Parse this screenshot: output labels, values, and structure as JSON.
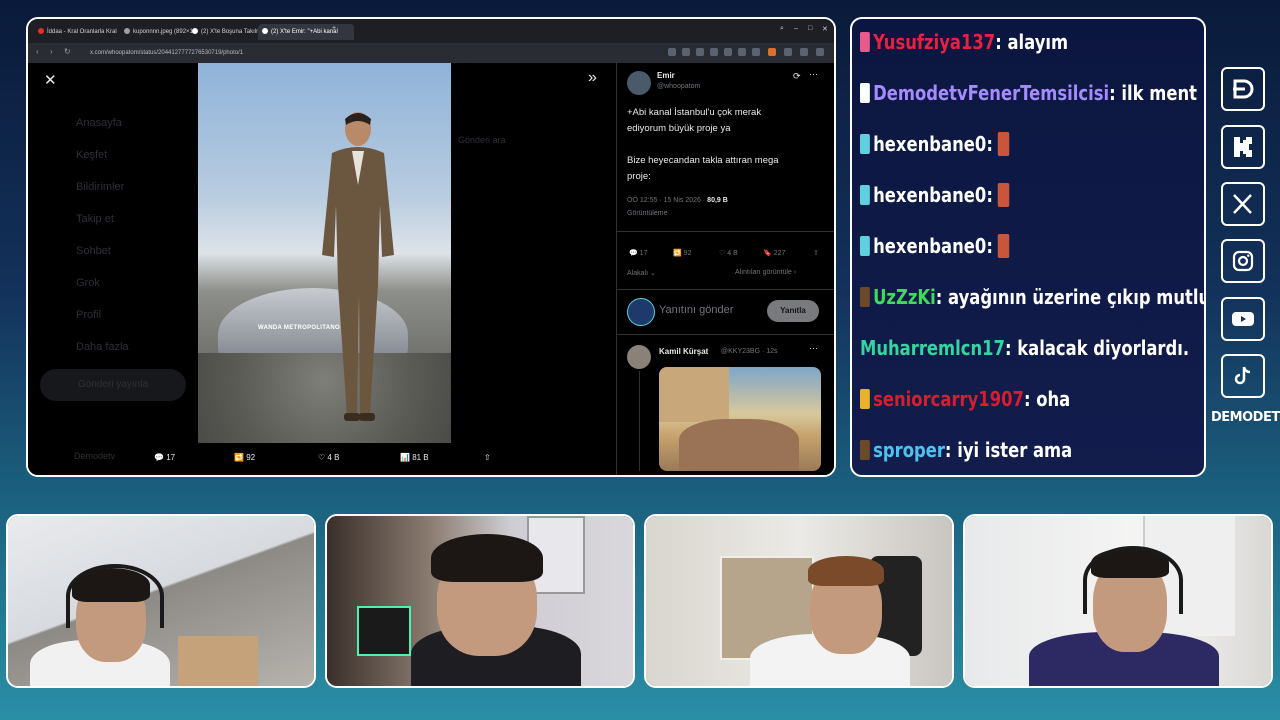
{
  "browser": {
    "tabs": [
      {
        "label": "İddaa - Kral Oranlarla Kral"
      },
      {
        "label": "kuponnnn.jpeg (892×1"
      },
      {
        "label": "(2) X'te Boşuna Takılma"
      },
      {
        "label": "(2) X'te Emir: \"+Abi kanal"
      }
    ],
    "url": "x.com/whoopatom/status/2044127777276530719/photo/1",
    "background_nav": [
      "Anasayfa",
      "Keşfet",
      "Bildirimler",
      "Takip et",
      "Sohbet",
      "Grok",
      "Profil",
      "Daha fazla"
    ],
    "background_button": "Gönderi yayınla",
    "background_user": "Demodetv",
    "background_search_hint": "Gönderi ara",
    "stadium_sign": "WANDA METROPOLITANO",
    "media_actions": {
      "replies": "17",
      "reposts": "92",
      "likes": "4 B",
      "views": "81 B"
    }
  },
  "tweet": {
    "name": "Emir",
    "handle": "@whoopatom",
    "text_line1": "+Abi kanal İstanbul'u çok merak",
    "text_line2": "ediyorum büyük proje ya",
    "text_line3": "Bize heyecandan takla attıran mega",
    "text_line4": "proje:",
    "timestamp": "ÖÖ 12:55 · 15 Nis 2026 ·",
    "views": "80,9 B",
    "views_label": "Görüntüleme",
    "stats": {
      "replies": "17",
      "reposts": "92",
      "likes": "4 B",
      "bookmarks": "227"
    },
    "sort_label": "Alakalı",
    "quotes_label": "Alıntıları görüntüle",
    "reply_placeholder": "Yanıtını gönder",
    "reply_button": "Yanıtla"
  },
  "reply_tweet": {
    "name": "Kamil Kürşat",
    "handle": "@KKY23BG",
    "time": "· 12s"
  },
  "chat": {
    "messages": [
      {
        "user": "Yusufziya137",
        "user_color": "#e8213d",
        "text": ": alayım",
        "badge_color": "#e85a8e"
      },
      {
        "user": "DemodetvFenerTemsilcisi",
        "user_color": "#a58bff",
        "text": ": ilk ment bağırttı",
        "badge_color": "#ffffff"
      },
      {
        "user": "hexenbane0",
        "user_color": "#ffffff",
        "text": ":",
        "badge_color": "#5fd0e0",
        "emote": true
      },
      {
        "user": "hexenbane0",
        "user_color": "#ffffff",
        "text": ":",
        "badge_color": "#5fd0e0",
        "emote": true
      },
      {
        "user": "hexenbane0",
        "user_color": "#ffffff",
        "text": ":",
        "badge_color": "#5fd0e0",
        "emote": true
      },
      {
        "user": "UzZzKi",
        "user_color": "#3ddc5a",
        "text": ": ayağının üzerine çıkıp mutlu olurduk",
        "badge_color": "#6b4a2a"
      },
      {
        "user": "Muharremlcn17",
        "user_color": "#34d6a0",
        "text": ": kalacak diyorlardı.",
        "badge_color": ""
      },
      {
        "user": "seniorcarry1907",
        "user_color": "#d61e2e",
        "text": ": oha",
        "badge_color": "#e8b32a"
      },
      {
        "user": "sproper",
        "user_color": "#4ec3f0",
        "text": ": iyi ister ama",
        "badge_color": "#6b4a2a"
      }
    ]
  },
  "socials": {
    "icons": [
      "demodetv-icon",
      "kick-icon",
      "x-icon",
      "instagram-icon",
      "youtube-icon",
      "tiktok-icon"
    ],
    "brand": "DEMODETV"
  }
}
